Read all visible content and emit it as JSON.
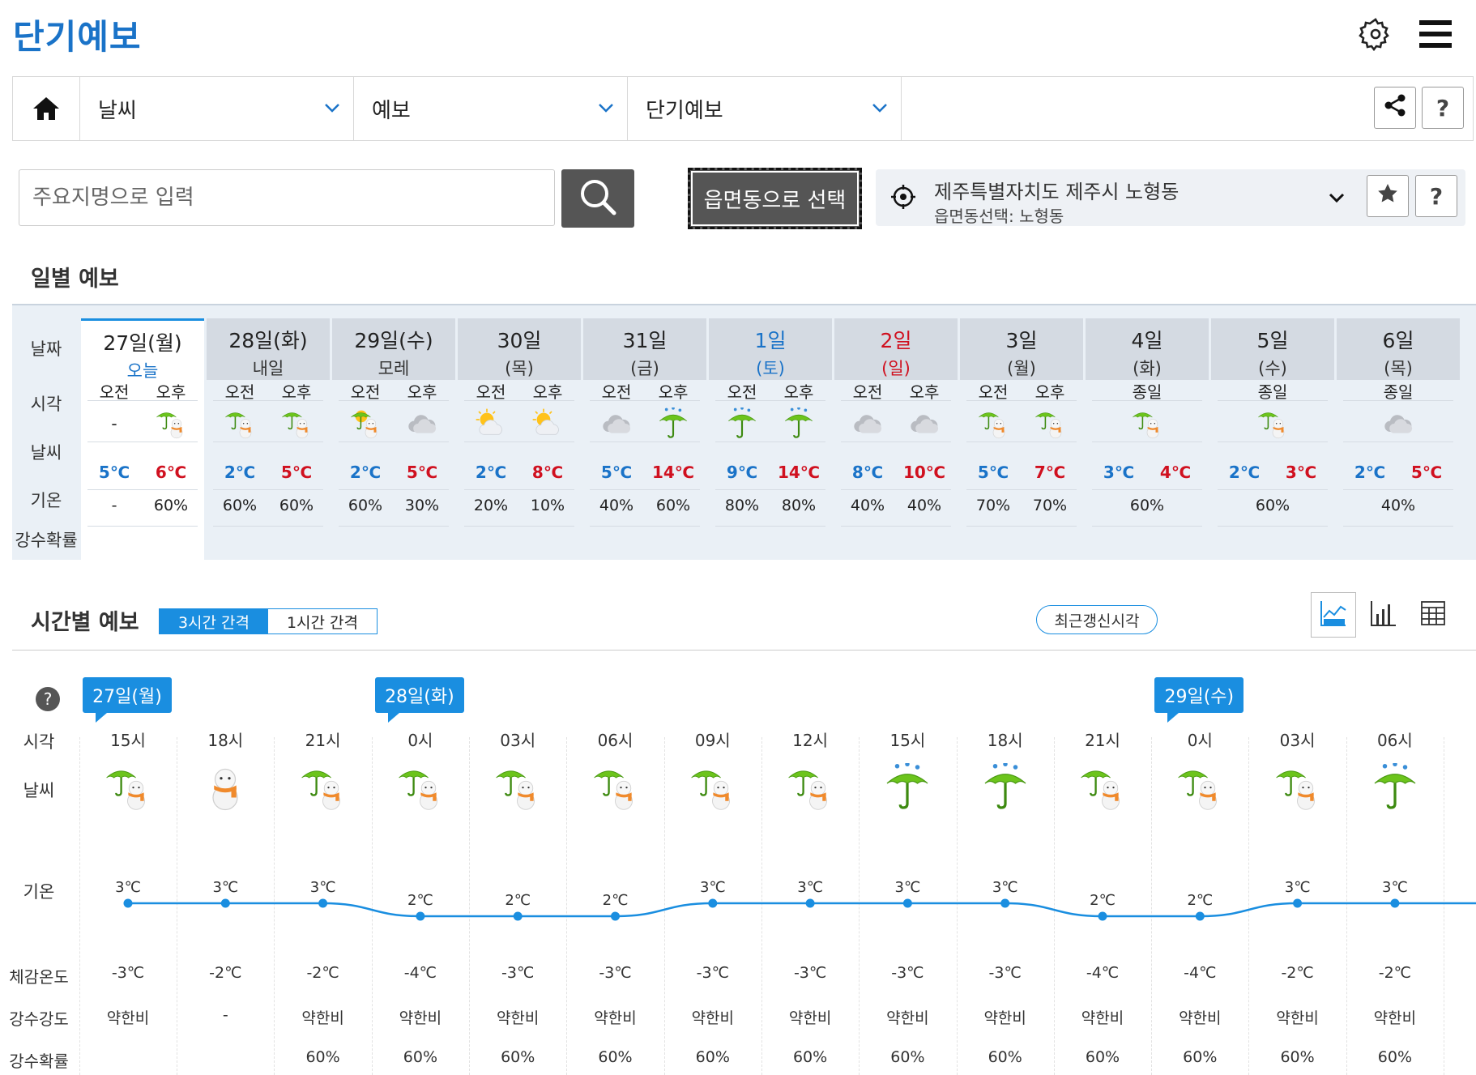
{
  "header": {
    "title": "단기예보"
  },
  "breadcrumb": [
    {
      "label": "날씨"
    },
    {
      "label": "예보"
    },
    {
      "label": "단기예보"
    }
  ],
  "breadcrumb_help": "?",
  "search": {
    "placeholder": "주요지명으로 입력"
  },
  "emd_button": "읍면동으로 선택",
  "location": {
    "main": "제주특별자치도 제주시 노형동",
    "sub": "읍면동선택: 노형동",
    "help": "?"
  },
  "daily": {
    "title": "일별 예보",
    "row_labels": {
      "date": "날짜",
      "time": "시각",
      "weather": "날씨",
      "temp": "기온",
      "precip": "강수확률"
    },
    "days": [
      {
        "date": "27일(월)",
        "sub": "오늘",
        "color": "normal",
        "today": true,
        "slots": [
          {
            "time": "오전",
            "icon": "none",
            "temp": "5℃",
            "precip": "-"
          },
          {
            "time": "오후",
            "icon": "snow-rain-icon",
            "temp": "6℃",
            "precip": "60%"
          }
        ]
      },
      {
        "date": "28일(화)",
        "sub": "내일",
        "color": "normal",
        "slots": [
          {
            "time": "오전",
            "icon": "snow-rain-icon",
            "temp": "2℃",
            "precip": "60%"
          },
          {
            "time": "오후",
            "icon": "snow-rain-icon",
            "temp": "5℃",
            "precip": "60%"
          }
        ]
      },
      {
        "date": "29일(수)",
        "sub": "모레",
        "color": "normal",
        "slots": [
          {
            "time": "오전",
            "icon": "sun-snow-rain-icon",
            "temp": "2℃",
            "precip": "60%"
          },
          {
            "time": "오후",
            "icon": "cloudy-icon",
            "temp": "5℃",
            "precip": "30%"
          }
        ]
      },
      {
        "date": "30일",
        "sub": "(목)",
        "color": "normal",
        "slots": [
          {
            "time": "오전",
            "icon": "partly-cloudy-icon",
            "temp": "2℃",
            "precip": "20%"
          },
          {
            "time": "오후",
            "icon": "partly-cloudy-icon",
            "temp": "8℃",
            "precip": "10%"
          }
        ]
      },
      {
        "date": "31일",
        "sub": "(금)",
        "color": "normal",
        "slots": [
          {
            "time": "오전",
            "icon": "cloudy-icon",
            "temp": "5℃",
            "precip": "40%"
          },
          {
            "time": "오후",
            "icon": "rain-icon",
            "temp": "14℃",
            "precip": "60%"
          }
        ]
      },
      {
        "date": "1일",
        "sub": "(토)",
        "color": "blue",
        "slots": [
          {
            "time": "오전",
            "icon": "rain-icon",
            "temp": "9℃",
            "precip": "80%"
          },
          {
            "time": "오후",
            "icon": "rain-icon",
            "temp": "14℃",
            "precip": "80%"
          }
        ]
      },
      {
        "date": "2일",
        "sub": "(일)",
        "color": "red",
        "slots": [
          {
            "time": "오전",
            "icon": "cloudy-icon",
            "temp": "8℃",
            "precip": "40%"
          },
          {
            "time": "오후",
            "icon": "cloudy-icon",
            "temp": "10℃",
            "precip": "40%"
          }
        ]
      },
      {
        "date": "3일",
        "sub": "(월)",
        "color": "normal",
        "slots": [
          {
            "time": "오전",
            "icon": "snow-rain-icon",
            "temp": "5℃",
            "precip": "70%"
          },
          {
            "time": "오후",
            "icon": "snow-rain-icon",
            "temp": "7℃",
            "precip": "70%"
          }
        ]
      },
      {
        "date": "4일",
        "sub": "(화)",
        "color": "normal",
        "allday": {
          "time": "종일",
          "icon": "snow-rain-icon",
          "temp_lo": "3℃",
          "temp_hi": "4℃",
          "precip": "60%"
        }
      },
      {
        "date": "5일",
        "sub": "(수)",
        "color": "normal",
        "allday": {
          "time": "종일",
          "icon": "snow-rain-icon",
          "temp_lo": "2℃",
          "temp_hi": "3℃",
          "precip": "60%"
        }
      },
      {
        "date": "6일",
        "sub": "(목)",
        "color": "normal",
        "allday": {
          "time": "종일",
          "icon": "cloudy-icon",
          "temp_lo": "2℃",
          "temp_hi": "5℃",
          "precip": "40%"
        }
      }
    ]
  },
  "hourly": {
    "title": "시간별 예보",
    "tabs": [
      {
        "label": "3시간 간격",
        "active": true
      },
      {
        "label": "1시간 간격",
        "active": false
      }
    ],
    "update_button": "최근갱신시각",
    "help": "?",
    "row_labels": {
      "time": "시각",
      "weather": "날씨",
      "temp": "기온",
      "feels": "체감온도",
      "intensity": "강수강도",
      "precip": "강수확률"
    },
    "date_tags": [
      {
        "label": "27일(월)",
        "at": 0
      },
      {
        "label": "28일(화)",
        "at": 3
      },
      {
        "label": "29일(수)",
        "at": 11
      }
    ],
    "hours": [
      {
        "time": "15시",
        "icon": "snow-rain-icon",
        "temp": 3,
        "temp_label": "3℃",
        "feels": "-3℃",
        "intensity": "약한비",
        "precip": ""
      },
      {
        "time": "18시",
        "icon": "snow-icon",
        "temp": 3,
        "temp_label": "3℃",
        "feels": "-2℃",
        "intensity": "-",
        "precip": ""
      },
      {
        "time": "21시",
        "icon": "snow-rain-icon",
        "temp": 3,
        "temp_label": "3℃",
        "feels": "-2℃",
        "intensity": "약한비",
        "precip": "60%"
      },
      {
        "time": "0시",
        "icon": "snow-rain-icon",
        "temp": 2,
        "temp_label": "2℃",
        "feels": "-4℃",
        "intensity": "약한비",
        "precip": "60%"
      },
      {
        "time": "03시",
        "icon": "snow-rain-icon",
        "temp": 2,
        "temp_label": "2℃",
        "feels": "-3℃",
        "intensity": "약한비",
        "precip": "60%"
      },
      {
        "time": "06시",
        "icon": "snow-rain-icon",
        "temp": 2,
        "temp_label": "2℃",
        "feels": "-3℃",
        "intensity": "약한비",
        "precip": "60%"
      },
      {
        "time": "09시",
        "icon": "snow-rain-icon",
        "temp": 3,
        "temp_label": "3℃",
        "feels": "-3℃",
        "intensity": "약한비",
        "precip": "60%"
      },
      {
        "time": "12시",
        "icon": "snow-rain-icon",
        "temp": 3,
        "temp_label": "3℃",
        "feels": "-3℃",
        "intensity": "약한비",
        "precip": "60%"
      },
      {
        "time": "15시",
        "icon": "rain-icon",
        "temp": 3,
        "temp_label": "3℃",
        "feels": "-3℃",
        "intensity": "약한비",
        "precip": "60%"
      },
      {
        "time": "18시",
        "icon": "rain-icon",
        "temp": 3,
        "temp_label": "3℃",
        "feels": "-3℃",
        "intensity": "약한비",
        "precip": "60%"
      },
      {
        "time": "21시",
        "icon": "snow-rain-icon",
        "temp": 2,
        "temp_label": "2℃",
        "feels": "-4℃",
        "intensity": "약한비",
        "precip": "60%"
      },
      {
        "time": "0시",
        "icon": "snow-rain-icon",
        "temp": 2,
        "temp_label": "2℃",
        "feels": "-4℃",
        "intensity": "약한비",
        "precip": "60%"
      },
      {
        "time": "03시",
        "icon": "snow-rain-icon",
        "temp": 3,
        "temp_label": "3℃",
        "feels": "-2℃",
        "intensity": "약한비",
        "precip": "60%"
      },
      {
        "time": "06시",
        "icon": "rain-icon",
        "temp": 3,
        "temp_label": "3℃",
        "feels": "-2℃",
        "intensity": "약한비",
        "precip": "60%"
      }
    ]
  },
  "chart_data": {
    "type": "line",
    "x": [
      "15시",
      "18시",
      "21시",
      "0시",
      "03시",
      "06시",
      "09시",
      "12시",
      "15시",
      "18시",
      "21시",
      "0시",
      "03시",
      "06시"
    ],
    "series": [
      {
        "values": [
          3,
          3,
          3,
          2,
          2,
          2,
          3,
          3,
          3,
          3,
          2,
          2,
          3,
          3
        ]
      }
    ],
    "color": "#1a8ee0"
  },
  "colors": {
    "accent": "#1a8ee0",
    "title": "#1a73c8",
    "sunday": "#d0101f",
    "saturday": "#1a73c8"
  }
}
